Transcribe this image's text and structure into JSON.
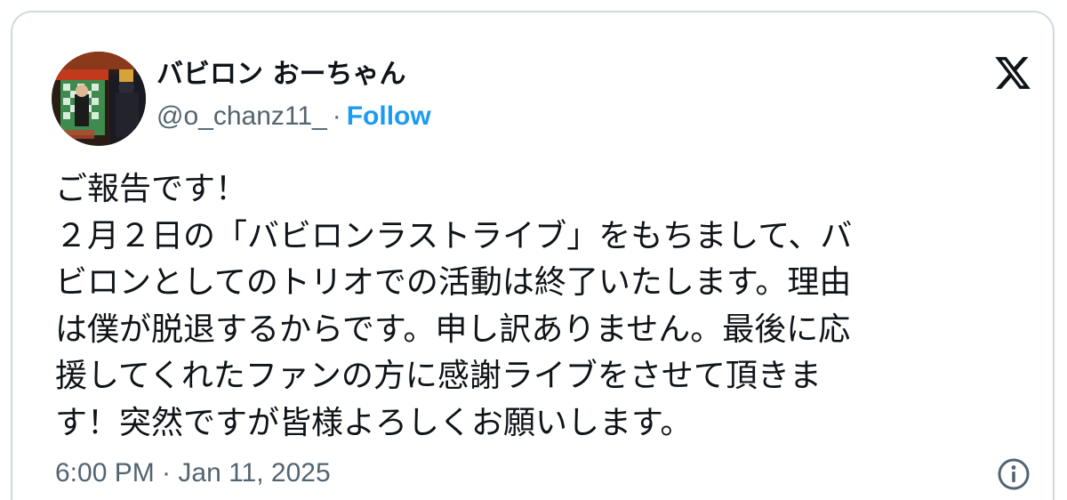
{
  "tweet": {
    "author": {
      "display_name": "バビロン おーちゃん",
      "handle": "@o_chanz11_",
      "separator": "·",
      "follow_label": "Follow",
      "avatar_icon": "profile-photo-icon"
    },
    "brand_icon": "x-logo-icon",
    "text_lines": [
      "ご報告です！",
      "２月２日の「バビロンラストライブ」をもちまして、バ",
      "ビロンとしてのトリオでの活動は終了いたします。理由",
      "は僕が脱退するからです。申し訳ありません。最後に応",
      "援してくれたファンの方に感謝ライブをさせて頂きま",
      "す！突然ですが皆様よろしくお願いします。"
    ],
    "timestamp": "6:00 PM · Jan 11, 2025",
    "info_icon": "info-icon"
  },
  "colors": {
    "text_primary": "#0f1419",
    "text_secondary": "#536471",
    "accent": "#1d9bf0",
    "border": "#cfd9de"
  }
}
